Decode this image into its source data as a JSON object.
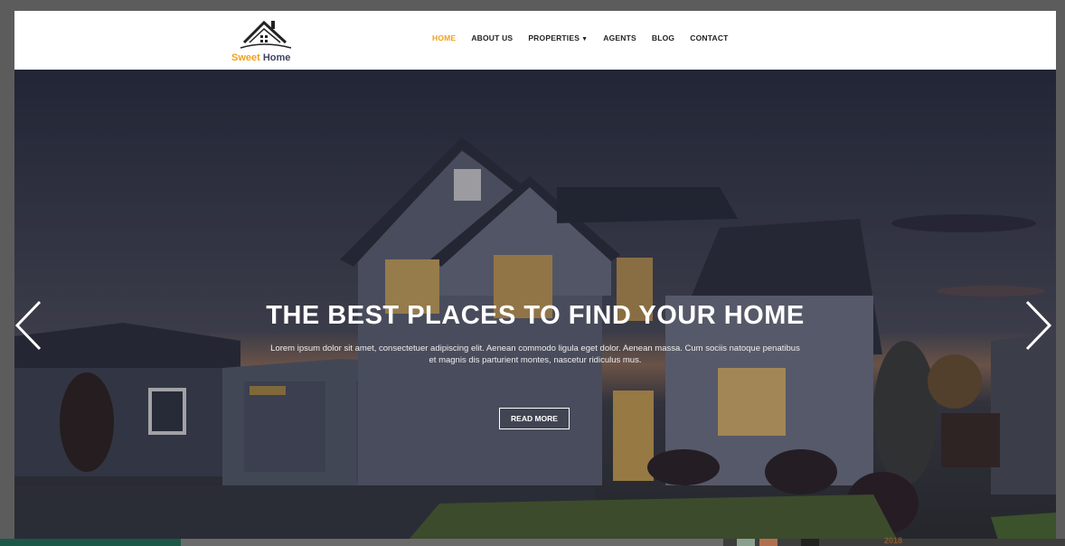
{
  "brand": {
    "name_part1": "Sweet",
    "name_part2": "Home",
    "logo_icon": "house-roof-icon"
  },
  "nav": {
    "items": [
      {
        "label": "HOME",
        "active": true
      },
      {
        "label": "ABOUT US",
        "active": false
      },
      {
        "label": "PROPERTIES",
        "active": false,
        "has_dropdown": true
      },
      {
        "label": "AGENTS",
        "active": false
      },
      {
        "label": "BLOG",
        "active": false
      },
      {
        "label": "CONTACT",
        "active": false
      }
    ]
  },
  "hero": {
    "headline": "THE BEST PLACES TO FIND YOUR HOME",
    "subtext": "Lorem ipsum dolor sit amet, consectetuer adipiscing elit. Aenean commodo ligula eget dolor. Aenean massa. Cum sociis natoque penatibus et magnis dis parturient montes, nascetur ridiculus mus.",
    "cta_label": "READ MORE",
    "prev_icon": "chevron-left-icon",
    "next_icon": "chevron-right-icon"
  },
  "footer_peek": {
    "year": "2018"
  },
  "colors": {
    "accent": "#f0a21b",
    "brand_dark": "#3d4463",
    "nav_text": "#222222",
    "white": "#ffffff"
  }
}
